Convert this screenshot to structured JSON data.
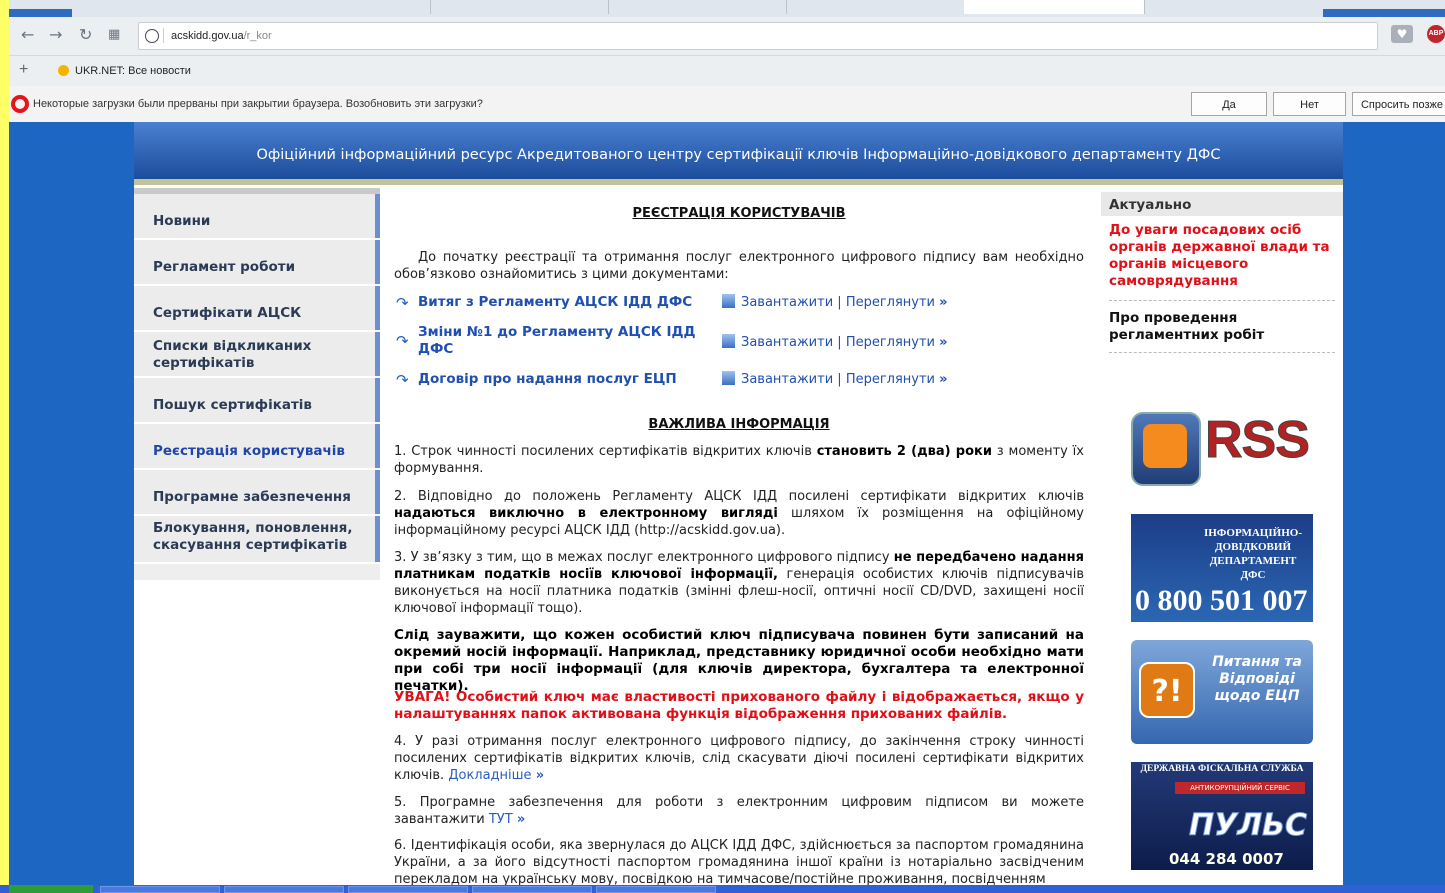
{
  "browser": {
    "address_host": "acskidd.gov.ua",
    "address_path": "/r_kor",
    "bookmark": "UKR.NET: Все новости",
    "notification": "Некоторые загрузки были прерваны при закрытии браузера. Возобновить эти загрузки?",
    "btn_yes": "Да",
    "btn_no": "Нет",
    "btn_later": "Спросить позже"
  },
  "header": {
    "title": "Офіційний інформаційний ресурс Акредитованого центру сертифікації ключів Інформаційно-довідкового департаменту ДФС"
  },
  "nav": [
    "Новини",
    "Регламент роботи",
    "Сертифікати АЦСК",
    "Списки відкликаних сертифікатів",
    "Пошук сертифікатів",
    "Реєстрація користувачів",
    "Програмне забезпечення",
    "Блокування, поновлення, скасування сертифікатів"
  ],
  "content": {
    "title": "РЕЄСТРАЦІЯ КОРИСТУВАЧІВ",
    "intro": "До початку реєстрації та отримання послуг електронного цифрового підпису вам необхідно обов’язково ознайомитись з цими документами:",
    "docs": [
      {
        "name": "Витяг з Регламенту АЦСК ІДД ДФС"
      },
      {
        "name": "Зміни №1 до Регламенту АЦСК ІДД ДФС"
      },
      {
        "name": "Договір про надання послуг ЕЦП"
      }
    ],
    "download": "Завантажити",
    "view": "Переглянути",
    "important_title": "ВАЖЛИВА ІНФОРМАЦІЯ",
    "p1_a": "1. Строк чинності посилених сертифікатів відкритих ключів ",
    "p1_b": "становить 2 (два) роки",
    "p1_c": " з моменту їх формування.",
    "p2_a": "2. Відповідно до положень Регламенту АЦСК ІДД посилені сертифікати відкритих ключів ",
    "p2_b": "надаються виключно в електронному вигляді",
    "p2_c": " шляхом їх розміщення на офіційному інформаційному ресурсі АЦСК ІДД (http://acskidd.gov.ua).",
    "p3_a": "3. У зв’язку з тим, що в межах послуг електронного цифрового підпису ",
    "p3_b": "не передбачено надання платникам податків носіїв ключової інформації,",
    "p3_c": " генерація особистих ключів підписувачів виконується на носії платника податків (змінні флеш-носії, оптичні носії CD/DVD, захищені носії ключової інформації тощо).",
    "p4": "Слід зауважити, що кожен особистий ключ підписувача повинен бути записаний на окремий носій інформації. Наприклад, представнику юридичної особи необхідно мати при собі три носії інформації (для ключів директора, бухгалтера та електронної печатки).",
    "p5": "УВАГА! Особистий ключ має властивості прихованого файлу і відображається, якщо у налаштуваннях папок активована функція відображення прихованих файлів.",
    "p6_a": "4. У разі отримання послуг електронного цифрового підпису, до закінчення строку чинності посилених сертифікатів відкритих ключів, слід скасувати діючі посилені сертифікати відкритих ключів. ",
    "p6_link": "Докладніше",
    "p7_a": "5. Програмне забезпечення для роботи з електронним цифровим підписом ви можете завантажити ",
    "p7_link": "ТУТ",
    "p8": "6. Ідентифікація особи, яка звернулася до АЦСК ІДД ДФС, здійснюється за паспортом громадянина України, а за його відсутності паспортом громадянина іншої країни із нотаріально засвідченим перекладом на українську мову, посвідкою на тимчасове/постійне проживання, посвідченням"
  },
  "sidebar": {
    "title": "Актуально",
    "news1": "До уваги посадових осіб органів державної влади та органів місцевого самоврядування",
    "news2": "Про проведення регламентних робіт",
    "rss": "RSS",
    "info_text": "ІНФОРМАЦІЙНО-ДОВІДКОВИЙ ДЕПАРТАМЕНТ ДФС",
    "info_phone": "0 800 501 007",
    "faq_icon": "?!",
    "faq_text": "Питання та Відповіді щодо ЕЦП",
    "puls_top": "ДЕРЖАВНА ФІСКАЛЬНА СЛУЖБА",
    "puls_mid": "АНТИКОРУПЦІЙНИЙ СЕРВІС",
    "puls_big": "ПУЛЬС",
    "puls_phone": "044 284 0007"
  },
  "colors": {
    "page_bg": "#1d67c3",
    "header_bg": "#2a5fb0",
    "link": "#1f4fb0",
    "warning": "#e01018"
  }
}
